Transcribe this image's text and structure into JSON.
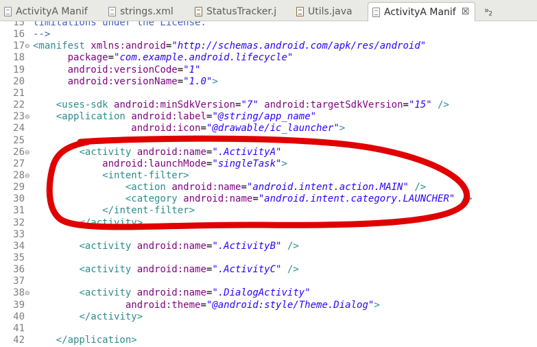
{
  "tabs": [
    {
      "label": "ActivityA Manif",
      "icon": "xml-file-icon",
      "active": false
    },
    {
      "label": "strings.xml",
      "icon": "xml-file-icon",
      "active": false
    },
    {
      "label": "StatusTracker.j",
      "icon": "java-file-icon",
      "active": false
    },
    {
      "label": "Utils.java",
      "icon": "java-file-icon",
      "active": false
    },
    {
      "label": "ActivityA Manif",
      "icon": "xml-file-icon",
      "active": true
    }
  ],
  "tab_close_symbol": "☒",
  "overflow": {
    "symbol": "»",
    "count": "2"
  },
  "colors": {
    "tag": "#2d8c8c",
    "attribute": "#7f007f",
    "value": "#2a00ff",
    "comment": "#3f5fbf",
    "annotation": "#e00000"
  },
  "lines": [
    {
      "num": "15",
      "fold": false,
      "indent": "",
      "tokens": [
        {
          "t": "c",
          "s": "limitations under the License."
        }
      ]
    },
    {
      "num": "16",
      "fold": false,
      "indent": "",
      "tokens": [
        {
          "t": "c",
          "s": "-->"
        }
      ]
    },
    {
      "num": "17",
      "fold": true,
      "indent": "",
      "tokens": [
        {
          "t": "t",
          "s": "<manifest"
        },
        {
          "t": "p",
          "s": " "
        },
        {
          "t": "a",
          "s": "xmlns:android"
        },
        {
          "t": "p",
          "s": "="
        },
        {
          "t": "v",
          "s": "\"http://schemas.android.com/apk/res/android\""
        }
      ]
    },
    {
      "num": "18",
      "fold": false,
      "indent": "      ",
      "tokens": [
        {
          "t": "a",
          "s": "package"
        },
        {
          "t": "p",
          "s": "="
        },
        {
          "t": "v",
          "s": "\"com.example.android.lifecycle\""
        }
      ]
    },
    {
      "num": "19",
      "fold": false,
      "indent": "      ",
      "tokens": [
        {
          "t": "a",
          "s": "android:versionCode"
        },
        {
          "t": "p",
          "s": "="
        },
        {
          "t": "v",
          "s": "\"1\""
        }
      ]
    },
    {
      "num": "20",
      "fold": false,
      "indent": "      ",
      "tokens": [
        {
          "t": "a",
          "s": "android:versionName"
        },
        {
          "t": "p",
          "s": "="
        },
        {
          "t": "v",
          "s": "\"1.0\""
        },
        {
          "t": "t",
          "s": ">"
        }
      ]
    },
    {
      "num": "21",
      "fold": false,
      "indent": "",
      "tokens": []
    },
    {
      "num": "22",
      "fold": false,
      "indent": "    ",
      "tokens": [
        {
          "t": "t",
          "s": "<uses-sdk"
        },
        {
          "t": "p",
          "s": " "
        },
        {
          "t": "a",
          "s": "android:minSdkVersion"
        },
        {
          "t": "p",
          "s": "="
        },
        {
          "t": "v",
          "s": "\"7\""
        },
        {
          "t": "p",
          "s": " "
        },
        {
          "t": "a",
          "s": "android:targetSdkVersion"
        },
        {
          "t": "p",
          "s": "="
        },
        {
          "t": "v",
          "s": "\"15\""
        },
        {
          "t": "p",
          "s": " "
        },
        {
          "t": "t",
          "s": "/>"
        }
      ]
    },
    {
      "num": "23",
      "fold": true,
      "indent": "    ",
      "tokens": [
        {
          "t": "t",
          "s": "<application"
        },
        {
          "t": "p",
          "s": " "
        },
        {
          "t": "a",
          "s": "android:label"
        },
        {
          "t": "p",
          "s": "="
        },
        {
          "t": "v",
          "s": "\"@string/app_name\""
        }
      ]
    },
    {
      "num": "24",
      "fold": false,
      "indent": "                 ",
      "tokens": [
        {
          "t": "a",
          "s": "android:icon"
        },
        {
          "t": "p",
          "s": "="
        },
        {
          "t": "v",
          "s": "\"@drawable/ic_launcher\""
        },
        {
          "t": "t",
          "s": ">"
        }
      ]
    },
    {
      "num": "25",
      "fold": false,
      "indent": "",
      "tokens": []
    },
    {
      "num": "26",
      "fold": true,
      "indent": "        ",
      "tokens": [
        {
          "t": "t",
          "s": "<activity"
        },
        {
          "t": "p",
          "s": " "
        },
        {
          "t": "a",
          "s": "android:name"
        },
        {
          "t": "p",
          "s": "="
        },
        {
          "t": "v",
          "s": "\".ActivityA\""
        }
      ]
    },
    {
      "num": "27",
      "fold": false,
      "indent": "            ",
      "tokens": [
        {
          "t": "a",
          "s": "android:launchMode"
        },
        {
          "t": "p",
          "s": "="
        },
        {
          "t": "v",
          "s": "\"singleTask\""
        },
        {
          "t": "t",
          "s": ">"
        }
      ]
    },
    {
      "num": "28",
      "fold": true,
      "indent": "            ",
      "tokens": [
        {
          "t": "t",
          "s": "<intent-filter>"
        }
      ]
    },
    {
      "num": "29",
      "fold": false,
      "indent": "                ",
      "tokens": [
        {
          "t": "t",
          "s": "<action"
        },
        {
          "t": "p",
          "s": " "
        },
        {
          "t": "a",
          "s": "android:name"
        },
        {
          "t": "p",
          "s": "="
        },
        {
          "t": "v",
          "s": "\"android.intent.action.MAIN\""
        },
        {
          "t": "p",
          "s": " "
        },
        {
          "t": "t",
          "s": "/>"
        }
      ]
    },
    {
      "num": "30",
      "fold": false,
      "indent": "                ",
      "tokens": [
        {
          "t": "t",
          "s": "<category"
        },
        {
          "t": "p",
          "s": " "
        },
        {
          "t": "a",
          "s": "android:name"
        },
        {
          "t": "p",
          "s": "="
        },
        {
          "t": "v",
          "s": "\"android.intent.category.LAUNCHER\""
        },
        {
          "t": "p",
          "s": " "
        },
        {
          "t": "t",
          "s": "/>"
        }
      ]
    },
    {
      "num": "31",
      "fold": false,
      "indent": "            ",
      "tokens": [
        {
          "t": "t",
          "s": "</intent-filter>"
        }
      ]
    },
    {
      "num": "32",
      "fold": false,
      "indent": "        ",
      "tokens": [
        {
          "t": "t",
          "s": "</activity>"
        }
      ]
    },
    {
      "num": "33",
      "fold": false,
      "indent": "",
      "tokens": []
    },
    {
      "num": "34",
      "fold": false,
      "indent": "        ",
      "tokens": [
        {
          "t": "t",
          "s": "<activity"
        },
        {
          "t": "p",
          "s": " "
        },
        {
          "t": "a",
          "s": "android:name"
        },
        {
          "t": "p",
          "s": "="
        },
        {
          "t": "v",
          "s": "\".ActivityB\""
        },
        {
          "t": "p",
          "s": " "
        },
        {
          "t": "t",
          "s": "/>"
        }
      ]
    },
    {
      "num": "35",
      "fold": false,
      "indent": "",
      "tokens": []
    },
    {
      "num": "36",
      "fold": false,
      "indent": "        ",
      "tokens": [
        {
          "t": "t",
          "s": "<activity"
        },
        {
          "t": "p",
          "s": " "
        },
        {
          "t": "a",
          "s": "android:name"
        },
        {
          "t": "p",
          "s": "="
        },
        {
          "t": "v",
          "s": "\".ActivityC\""
        },
        {
          "t": "p",
          "s": " "
        },
        {
          "t": "t",
          "s": "/>"
        }
      ]
    },
    {
      "num": "37",
      "fold": false,
      "indent": "",
      "tokens": []
    },
    {
      "num": "38",
      "fold": true,
      "indent": "        ",
      "tokens": [
        {
          "t": "t",
          "s": "<activity"
        },
        {
          "t": "p",
          "s": " "
        },
        {
          "t": "a",
          "s": "android:name"
        },
        {
          "t": "p",
          "s": "="
        },
        {
          "t": "v",
          "s": "\".DialogActivity\""
        }
      ]
    },
    {
      "num": "39",
      "fold": false,
      "indent": "                ",
      "tokens": [
        {
          "t": "a",
          "s": "android:theme"
        },
        {
          "t": "p",
          "s": "="
        },
        {
          "t": "v",
          "s": "\"@android:style/Theme.Dialog\""
        },
        {
          "t": "t",
          "s": ">"
        }
      ]
    },
    {
      "num": "40",
      "fold": false,
      "indent": "        ",
      "tokens": [
        {
          "t": "t",
          "s": "</activity>"
        }
      ]
    },
    {
      "num": "41",
      "fold": false,
      "indent": "",
      "tokens": []
    },
    {
      "num": "42",
      "fold": false,
      "indent": "    ",
      "tokens": [
        {
          "t": "t",
          "s": "</application>"
        }
      ]
    }
  ]
}
